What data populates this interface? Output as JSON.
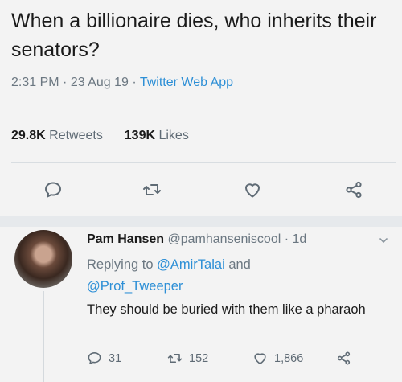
{
  "tweet": {
    "text": "When a billionaire dies, who inherits their senators?",
    "time": "2:31 PM",
    "sep1": " · ",
    "date": "23 Aug 19",
    "sep2": " · ",
    "app": "Twitter Web App",
    "retweets_count": "29.8K",
    "retweets_label": "Retweets",
    "likes_count": "139K",
    "likes_label": "Likes"
  },
  "actions": {
    "reply_icon": "reply-icon",
    "retweet_icon": "retweet-icon",
    "like_icon": "heart-icon",
    "share_icon": "share-icon"
  },
  "reply": {
    "name": "Pam Hansen",
    "handle": "@pamhanseniscool",
    "sep": " · ",
    "age": "1d",
    "replying_prefix": "Replying to ",
    "mention1": "@AmirTalai",
    "and": " and",
    "mention2": "@Prof_Tweeper",
    "text": "They should be buried with them like a pharaoh",
    "reply_count": "31",
    "retweet_count": "152",
    "like_count": "1,866"
  },
  "colors": {
    "link": "#2d8fd6",
    "muted": "#6b7781",
    "background": "#f3f3f3"
  }
}
